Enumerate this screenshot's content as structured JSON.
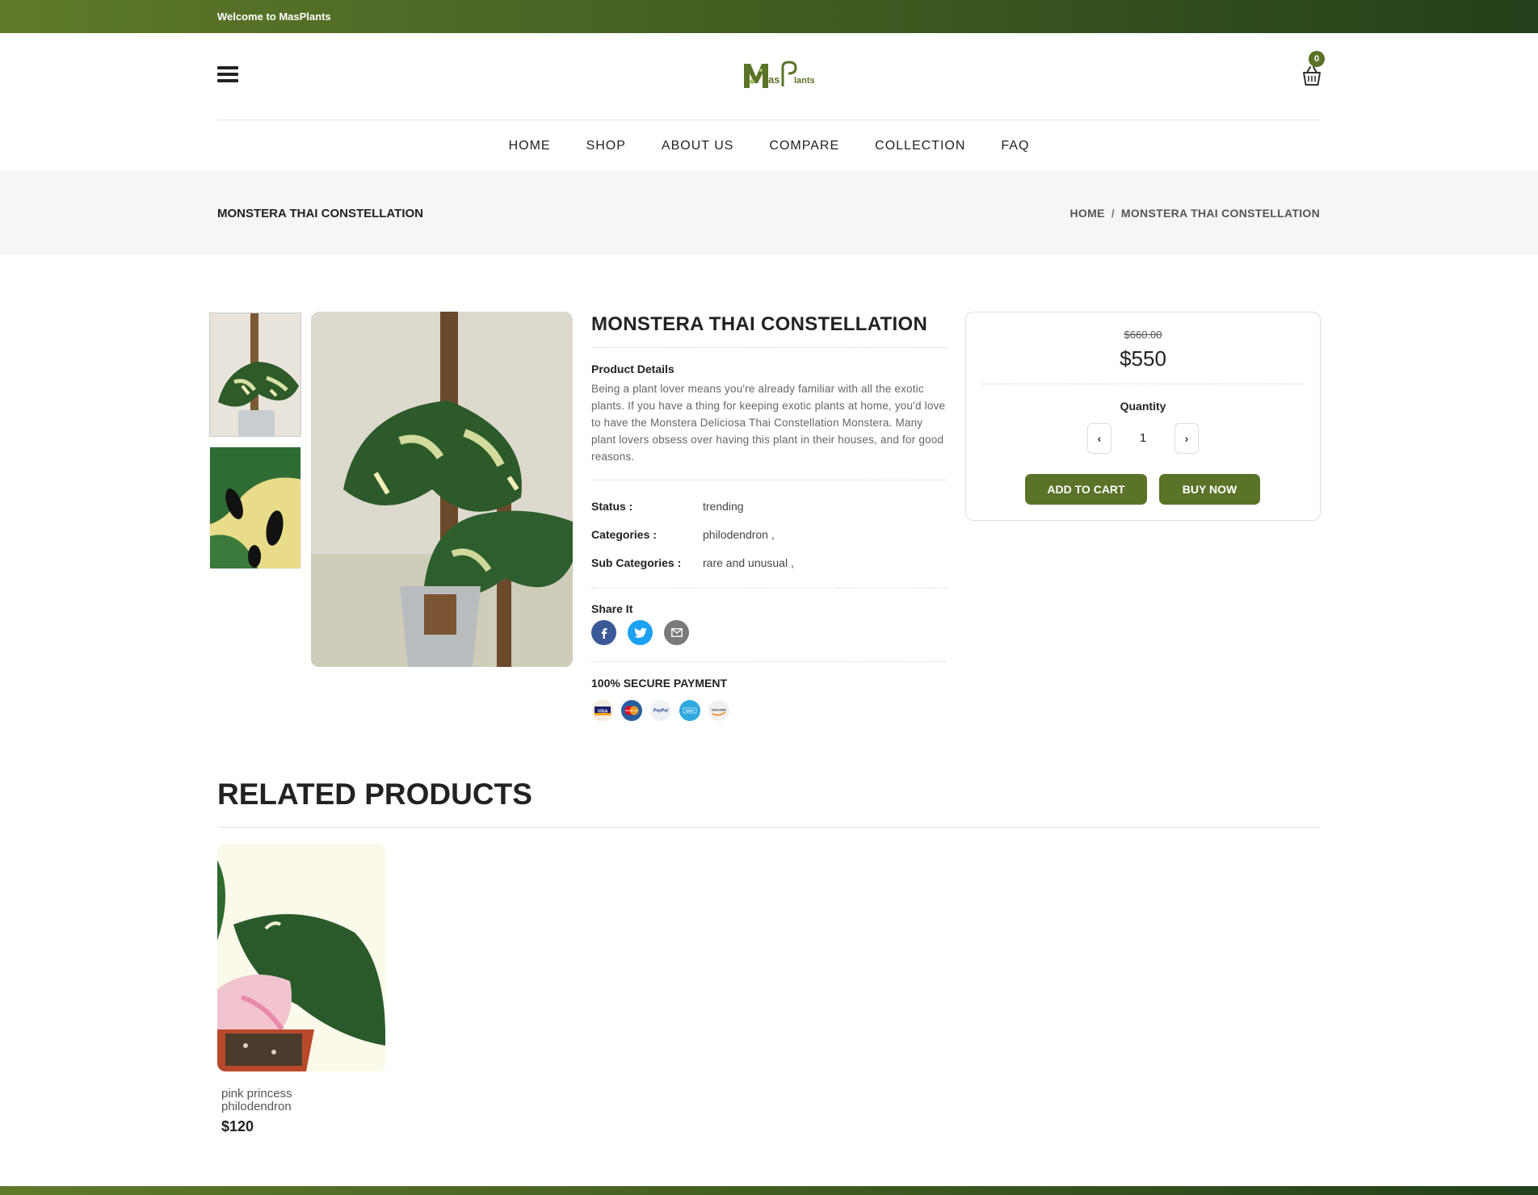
{
  "topbar": {
    "welcome": "Welcome to MasPlants"
  },
  "header": {
    "logo_text": "MasPlants",
    "cart_count": "0"
  },
  "nav": {
    "items": [
      "HOME",
      "SHOP",
      "ABOUT US",
      "COMPARE",
      "COLLECTION",
      "FAQ"
    ]
  },
  "page_title": "MONSTERA THAI CONSTELLATION",
  "breadcrumb": {
    "home": "HOME",
    "sep": "/",
    "current": "MONSTERA THAI CONSTELLATION"
  },
  "product": {
    "title": "MONSTERA THAI CONSTELLATION",
    "details_label": "Product Details",
    "description": "Being a plant lover means you're already familiar with all the exotic plants. If you have a thing for keeping exotic plants at home, you'd love to have the Monstera Deliciosa Thai Constellation Monstera. Many plant lovers obsess over having this plant in their houses, and for good reasons.",
    "meta": [
      {
        "key": "Status :",
        "value": "trending"
      },
      {
        "key": "Categories :",
        "value": "philodendron ,"
      },
      {
        "key": "Sub Categories :",
        "value": "rare and unusual ,"
      }
    ],
    "share_label": "Share It",
    "share_icons": [
      "facebook-icon",
      "twitter-icon",
      "email-icon"
    ],
    "secure_label": "100% SECURE PAYMENT",
    "payment_cards": [
      "VISA",
      "MasterCard",
      "PayPal",
      "AMEX",
      "DISCOVER"
    ]
  },
  "buybox": {
    "old_price": "$660.00",
    "price": "$550",
    "quantity_label": "Quantity",
    "quantity": "1",
    "minus": "‹",
    "plus": "›",
    "add_to_cart": "ADD TO CART",
    "buy_now": "BUY NOW"
  },
  "related": {
    "title": "RELATED PRODUCTS",
    "items": [
      {
        "name": "pink princess philodendron",
        "price": "$120"
      }
    ]
  },
  "colors": {
    "brand": "#5a7328",
    "topbar_dark": "#22401a",
    "facebook": "#3b5998",
    "twitter": "#1da1f2",
    "email": "#7a7a7a"
  }
}
